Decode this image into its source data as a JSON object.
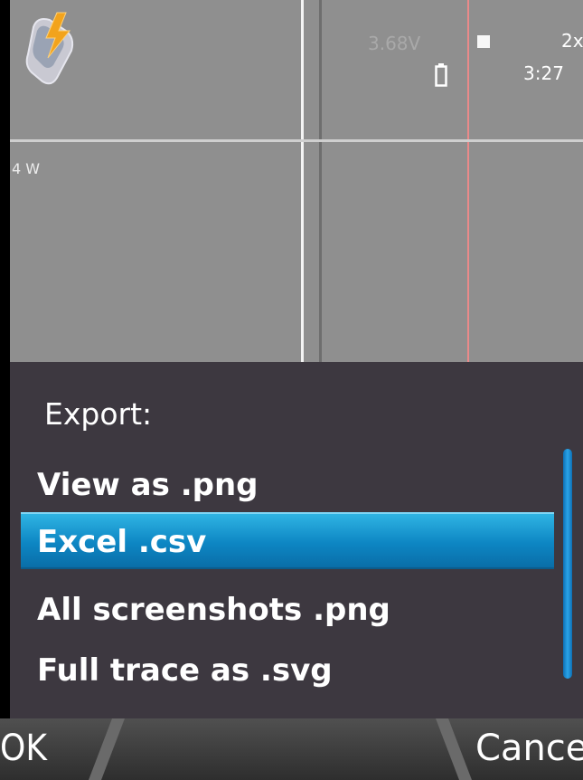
{
  "status": {
    "voltage": "3.68V",
    "speed": "2x",
    "time": "3:27"
  },
  "graph": {
    "power_label": "4 W"
  },
  "dialog": {
    "title": "Export:",
    "items": [
      {
        "label": "View as .png"
      },
      {
        "label": "Excel .csv",
        "selected": true
      },
      {
        "label": "All screenshots .png"
      },
      {
        "label": "Full trace as .svg"
      }
    ]
  },
  "softkeys": {
    "left": "OK",
    "right": "Cance"
  },
  "colors": {
    "graph_bg": "#8f8f8f",
    "dialog_bg": "#3d3840",
    "highlight": "#0d86c3",
    "marker_red": "#e98a8a"
  },
  "icons": [
    "phone-charging-icon",
    "battery-icon"
  ]
}
